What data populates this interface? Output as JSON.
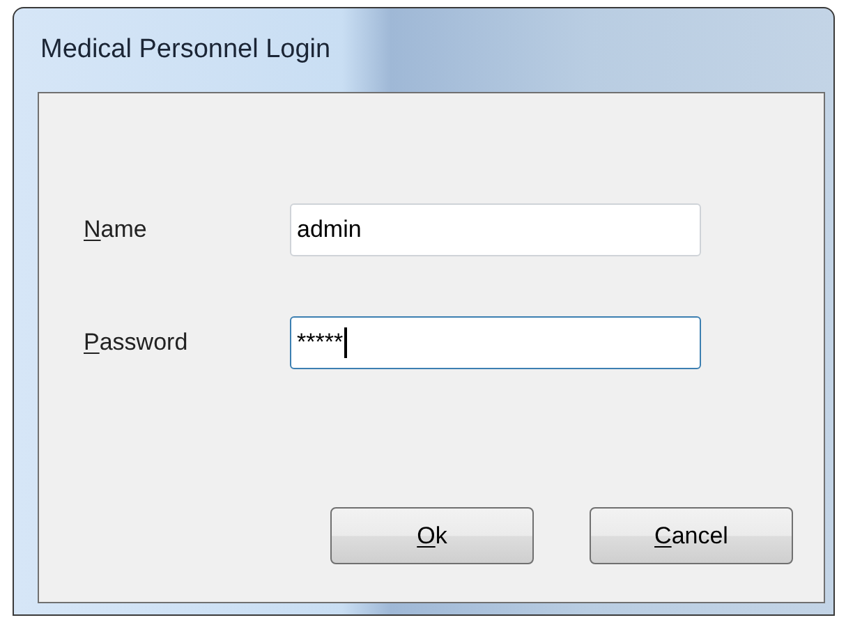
{
  "window": {
    "title": "Medical Personnel Login"
  },
  "fields": [
    {
      "label": {
        "access_key": "N",
        "rest": "ame"
      },
      "value": "admin",
      "focused": false
    },
    {
      "label": {
        "access_key": "P",
        "rest": "assword"
      },
      "value": "*****",
      "focused": true
    }
  ],
  "buttons": [
    {
      "label": {
        "access_key": "O",
        "rest": "k"
      }
    },
    {
      "label": {
        "access_key": "C",
        "rest": "ancel"
      }
    }
  ]
}
